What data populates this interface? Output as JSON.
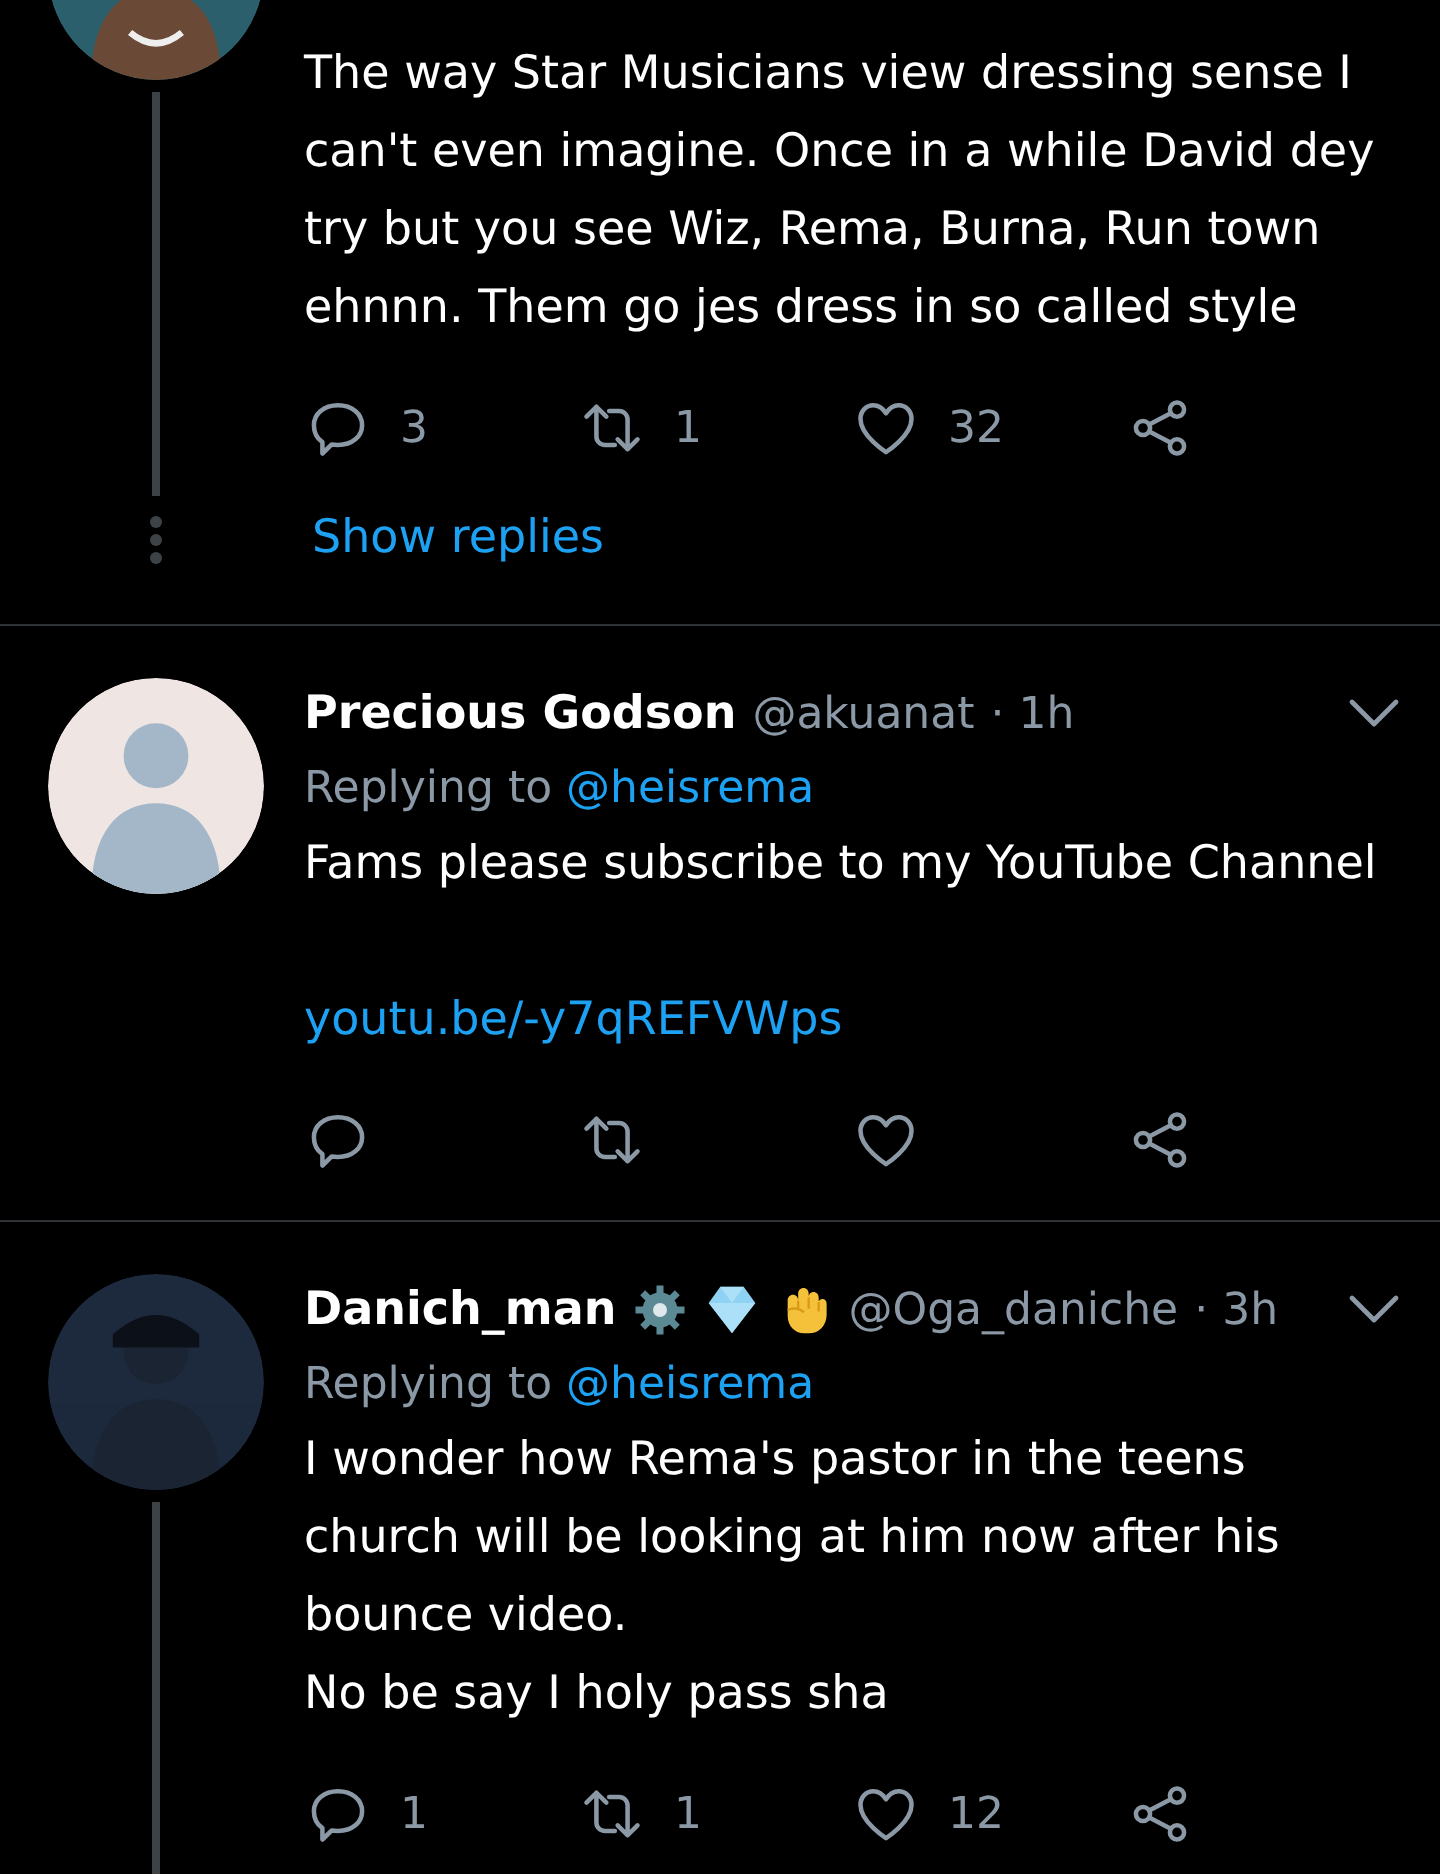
{
  "tweets": [
    {
      "kind": "partial",
      "thread_line": true,
      "paragraphs": [
        "The way Star Musicians view dressing sense I can't even imagine. Once in a while David dey try but you see Wiz, Rema, Burna, Run town ehnnn. Them go jes dress in so called style"
      ],
      "stats": {
        "replies": "3",
        "retweets": "1",
        "likes": "32"
      },
      "show_replies": "Show replies"
    },
    {
      "kind": "full",
      "thread_line": false,
      "name": "Precious Godson",
      "handle": "@akuanat",
      "time": "· 1h",
      "replying_label": "Replying to",
      "replying_to": "@heisrema",
      "paragraphs": [
        "Fams please subscribe to my YouTube Channel"
      ],
      "link": "youtu.be/-y7qREFVWps"
    },
    {
      "kind": "full",
      "thread_line": true,
      "name": "Danich_man",
      "badges": [
        {
          "kind": "gear"
        },
        {
          "kind": "gem"
        },
        {
          "kind": "fist"
        }
      ],
      "handle": "@Oga_daniche",
      "time": "· 3h",
      "replying_label": "Replying to",
      "replying_to": "@heisrema",
      "paragraphs": [
        "I wonder how Rema's pastor in the teens church will be looking at him now after his bounce video.",
        "No be say I holy pass sha"
      ],
      "stats": {
        "replies": "1",
        "retweets": "1",
        "likes": "12"
      }
    }
  ]
}
